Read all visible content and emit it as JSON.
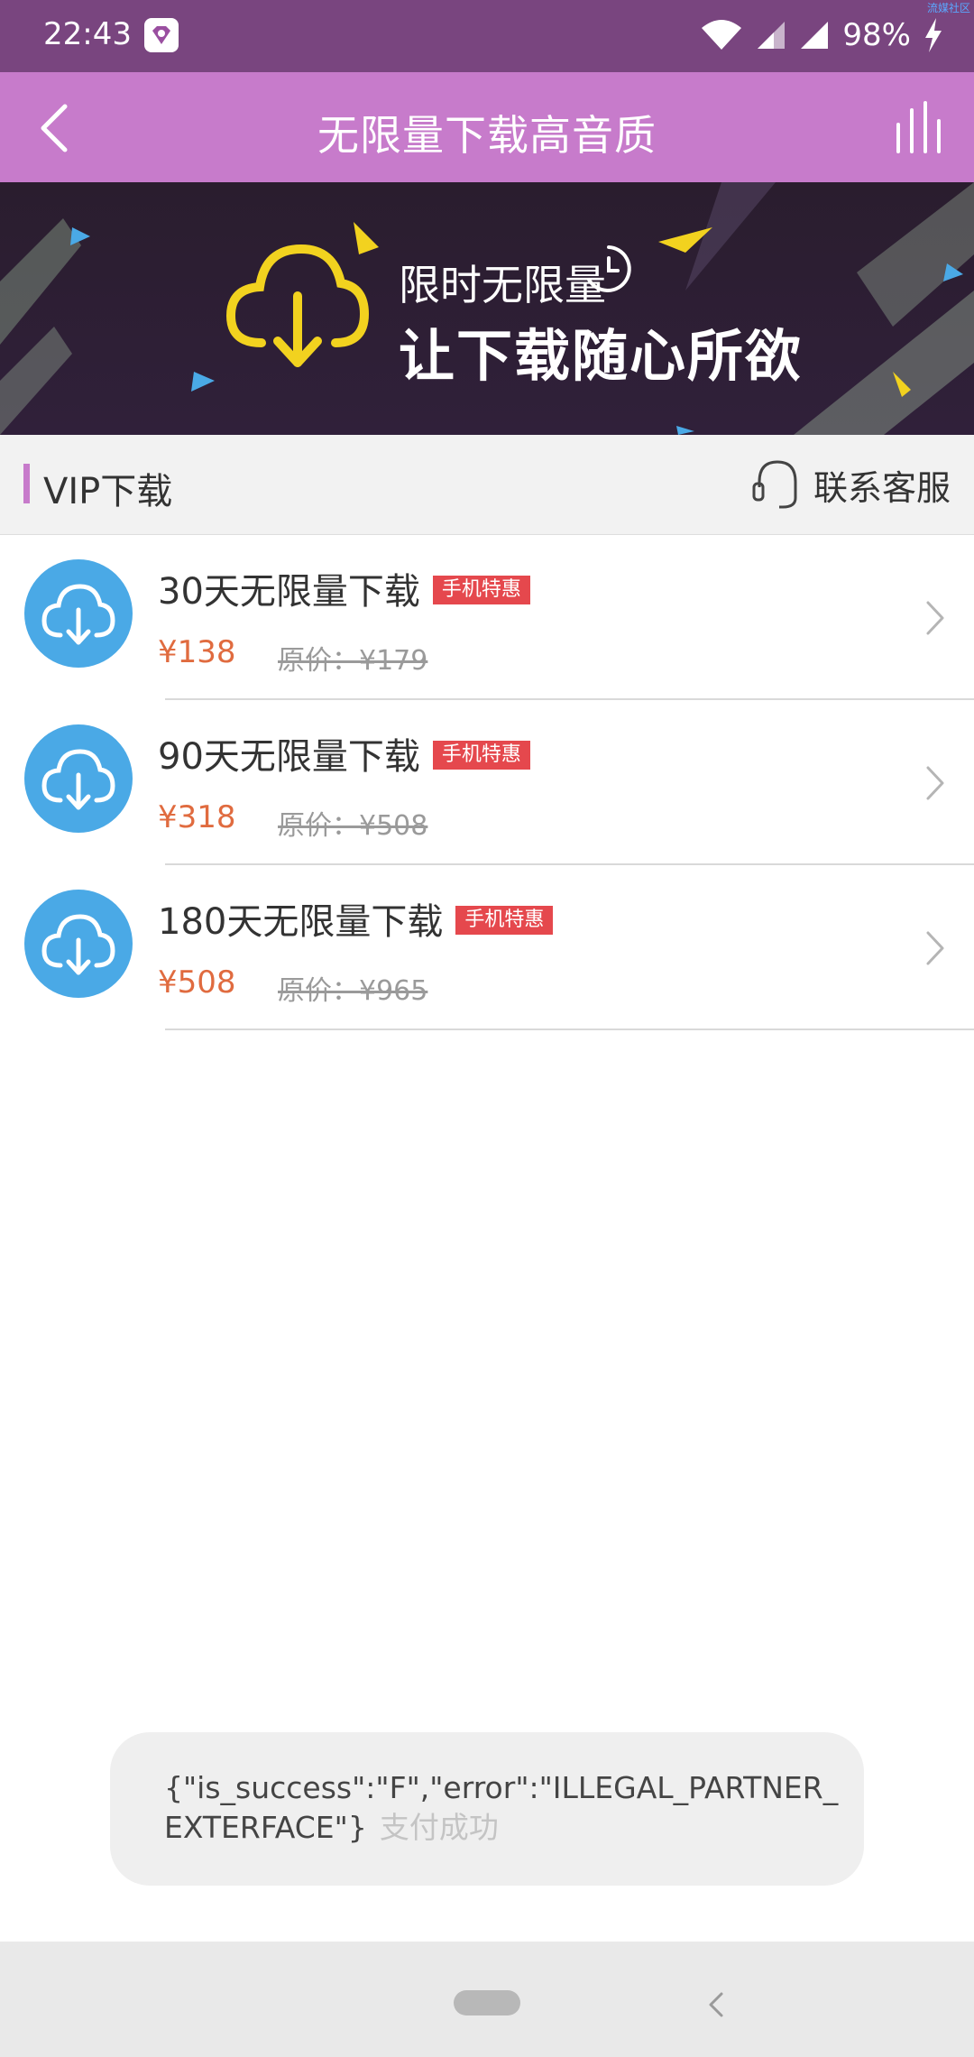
{
  "status_bar": {
    "time": "22:43",
    "battery": "98%",
    "corner_mark": "流媒社区",
    "icons": [
      "app-notification-icon",
      "wifi-icon",
      "signal-icon",
      "signal-icon",
      "charging-icon"
    ]
  },
  "app_bar": {
    "title": "无限量下载高音质",
    "back_icon": "chevron-left-icon",
    "right_icon": "equalizer-bars-icon"
  },
  "banner": {
    "line1": "限时无限量",
    "line2": "让下载随心所欲",
    "accent_color": "#f2d21f"
  },
  "section": {
    "title": "VIP下载",
    "service_label": "联系客服",
    "accent_color": "#c77bcb"
  },
  "plans": [
    {
      "title": "30天无限量下载",
      "badge": "手机特惠",
      "price": "¥138",
      "original": "原价：¥179"
    },
    {
      "title": "90天无限量下载",
      "badge": "手机特惠",
      "price": "¥318",
      "original": "原价：¥508"
    },
    {
      "title": "180天无限量下载",
      "badge": "手机特惠",
      "price": "¥508",
      "original": "原价：¥965"
    }
  ],
  "toast": {
    "message": "{\"is_success\":\"F\",\"error\":\"ILLEGAL_PARTNER_EXTERFACE\"}",
    "ghost_text": "支付成功"
  },
  "colors": {
    "status_bar": "#79457f",
    "app_bar": "#c77bcb",
    "price": "#e06b3f",
    "badge": "#e5484d",
    "icon_circle": "#4aa9e6"
  }
}
